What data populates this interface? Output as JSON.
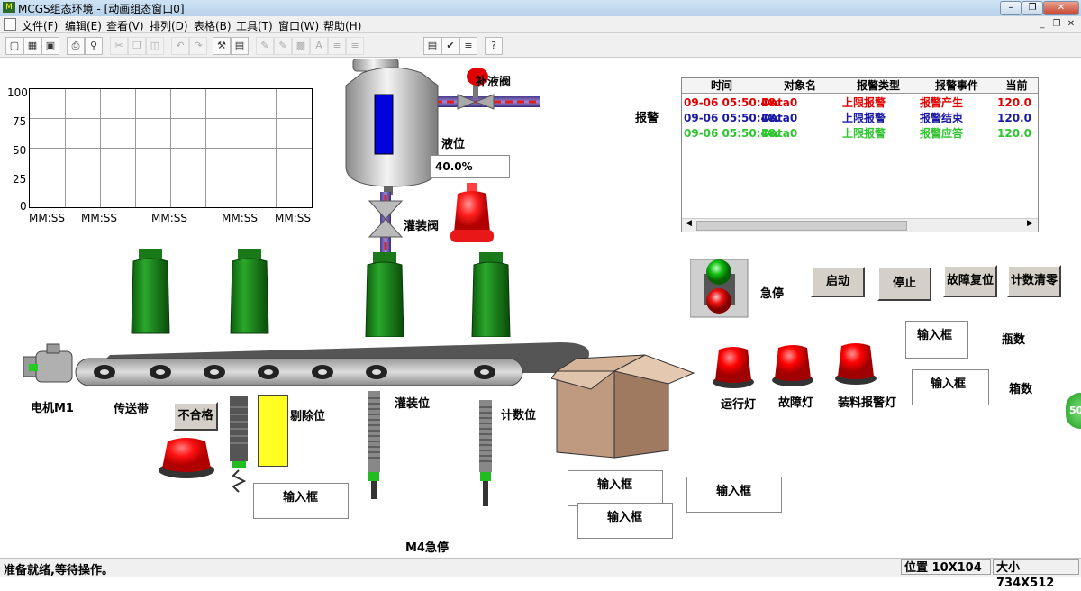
{
  "window": {
    "title": "MCGS组态环境 - [动画组态窗口0]",
    "logo_text": "M"
  },
  "menu": {
    "items": [
      "文件(F)",
      "编辑(E)",
      "查看(V)",
      "排列(D)",
      "表格(B)",
      "工具(T)",
      "窗口(W)",
      "帮助(H)"
    ]
  },
  "trend": {
    "y_ticks": [
      "100",
      "75",
      "50",
      "25",
      "0"
    ],
    "x_ticks": [
      "MM:SS",
      "MM:SS",
      "MM:SS",
      "MM:SS",
      "MM:SS"
    ]
  },
  "tank": {
    "refill_valve_label": "补液阀",
    "level_label": "液位",
    "level_value": "40.0%",
    "level_fraction": 0.4,
    "filling_valve_label": "灌装阀"
  },
  "alarm": {
    "side_label": "报警",
    "columns": [
      "时间",
      "对象名",
      "报警类型",
      "报警事件",
      "当前"
    ],
    "rows": [
      {
        "time": "09-06 05:50:48.",
        "object": "Data0",
        "type": "上限报警",
        "event": "报警产生",
        "value": "120.0",
        "color": "#e00000"
      },
      {
        "time": "09-06 05:50:48.",
        "object": "Data0",
        "type": "上限报警",
        "event": "报警结束",
        "value": "120.0",
        "color": "#1a1aa6"
      },
      {
        "time": "09-06 05:50:48.",
        "object": "Data0",
        "type": "上限报警",
        "event": "报警应答",
        "value": "120.0",
        "color": "#2ec52e"
      }
    ]
  },
  "controls": {
    "estop_label": "急停",
    "start": "启动",
    "stop": "停止",
    "fault_reset": "故障复位",
    "count_clear": "计数清零",
    "bottle_count_label": "瓶数",
    "box_count_label": "箱数",
    "input_box": "输入框"
  },
  "lamps": {
    "run": "运行灯",
    "fault": "故障灯",
    "load_alarm": "装料报警灯"
  },
  "line": {
    "motor": "电机M1",
    "conveyor": "传送带",
    "reject_button": "不合格",
    "reject_pos": "剔除位",
    "fill_pos": "灌装位",
    "count_pos": "计数位",
    "m4_estop": "M4急停"
  },
  "status": {
    "ready": "准备就绪,等待操作。",
    "position": "位置 10X104",
    "size": "大小 734X512"
  },
  "edge_badge": "50",
  "colors": {
    "bottle": "#1a7a1a",
    "lamp_red": "#e00000",
    "lamp_green": "#11c011",
    "level_bar": "#0000dd"
  }
}
